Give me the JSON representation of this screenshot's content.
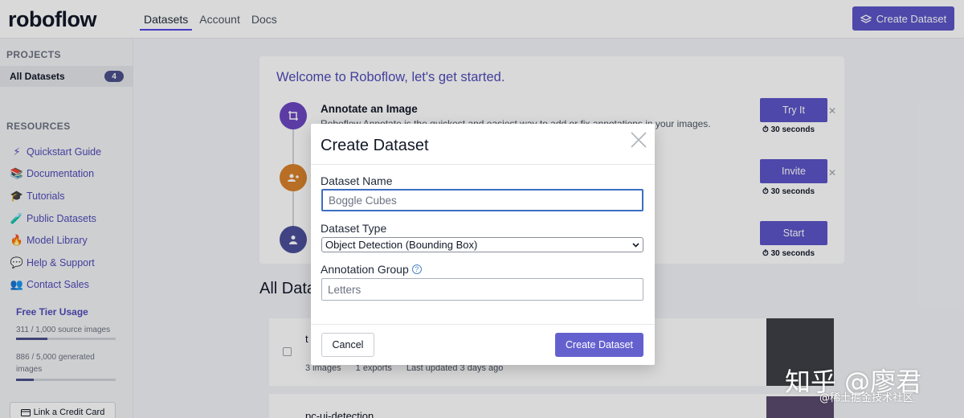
{
  "brand": "roboflow",
  "nav": {
    "tabs": [
      {
        "label": "Datasets",
        "active": true
      },
      {
        "label": "Account",
        "active": false
      },
      {
        "label": "Docs",
        "active": false
      }
    ],
    "create_button_label": "Create Dataset"
  },
  "sidebar": {
    "projects_heading": "PROJECTS",
    "all_datasets_label": "All Datasets",
    "all_datasets_count": "4",
    "resources_heading": "RESOURCES",
    "resources": [
      {
        "label": "Quickstart Guide",
        "icon": "⚡"
      },
      {
        "label": "Documentation",
        "icon": "📚"
      },
      {
        "label": "Tutorials",
        "icon": "🎓"
      },
      {
        "label": "Public Datasets",
        "icon": "🧪"
      },
      {
        "label": "Model Library",
        "icon": "🔥"
      },
      {
        "label": "Help & Support",
        "icon": "💬"
      },
      {
        "label": "Contact Sales",
        "icon": "👥"
      }
    ],
    "usage": {
      "title": "Free Tier Usage",
      "source_text": "311 / 1,000 source images",
      "source_fraction": 0.311,
      "generated_text": "886 / 5,000 generated images",
      "generated_fraction": 0.177
    },
    "credit_card_label": "Link a Credit Card"
  },
  "welcome": {
    "title": "Welcome to Roboflow, let's get started.",
    "steps": [
      {
        "title": "Annotate an Image",
        "description": "Roboflow Annotate is the quickest and easiest way to add or fix annotations in your images.",
        "button": "Try It",
        "time": "30 seconds",
        "color": "#6b46c1"
      },
      {
        "title": "",
        "description": "",
        "button": "Invite",
        "time": "30 seconds",
        "color": "#d9822b"
      },
      {
        "title": "",
        "description": "",
        "button": "Start",
        "time": "30 seconds",
        "color": "#4c4f9a"
      }
    ]
  },
  "datasets_heading": "All Datasets",
  "datasets": [
    {
      "name": "t",
      "meta_images": "3 images",
      "meta_exports": "1 exports",
      "meta_updated": "Last updated 3 days ago"
    },
    {
      "name": "pc-ui-detection"
    }
  ],
  "modal": {
    "title": "Create Dataset",
    "name_label": "Dataset Name",
    "name_placeholder": "Boggle Cubes",
    "type_label": "Dataset Type",
    "type_value": "Object Detection (Bounding Box)",
    "group_label": "Annotation Group",
    "group_placeholder": "Letters",
    "cancel_label": "Cancel",
    "submit_label": "Create Dataset"
  },
  "watermark": {
    "line1": "知乎 @廖君",
    "line2": "@稀土掘金技术社区"
  }
}
